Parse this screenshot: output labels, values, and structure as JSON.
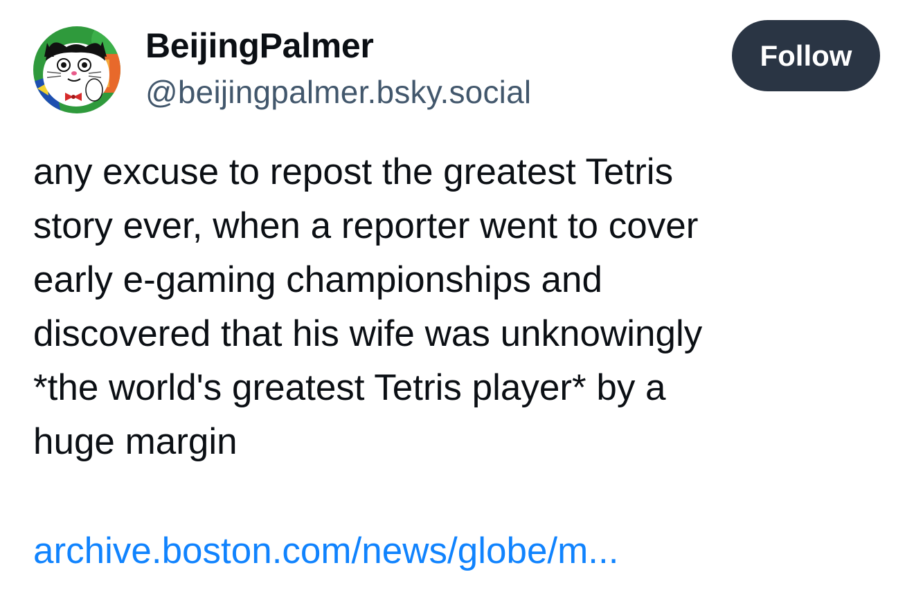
{
  "author": {
    "display_name": "BeijingPalmer",
    "handle": "@beijingpalmer.bsky.social",
    "avatar_icon": "cartoon-cat-avatar"
  },
  "follow_button": {
    "label": "Follow",
    "bg_color": "#2a3544",
    "text_color": "#ffffff"
  },
  "post": {
    "text": "any excuse to repost the greatest Tetris\nstory ever, when a reporter went to cover\nearly e-gaming championships and\ndiscovered that his wife was unknowingly\n*the world's greatest Tetris player* by a\nhuge margin",
    "link_text": "archive.boston.com/news/globe/m...",
    "link_color": "#1083fe"
  }
}
